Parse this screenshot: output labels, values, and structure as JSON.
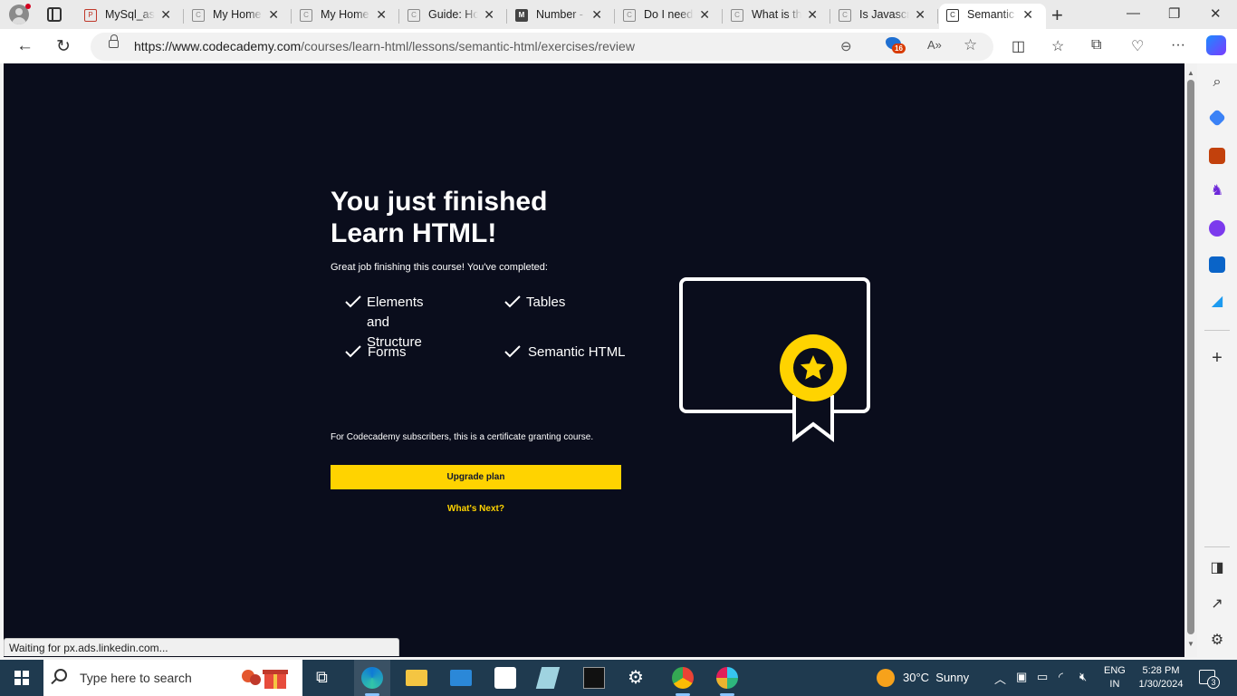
{
  "browser": {
    "tabs": [
      {
        "title": "MySql_assignment",
        "favicon": "pdf-icon"
      },
      {
        "title": "My Home | Codecademy",
        "favicon": "codecademy-icon"
      },
      {
        "title": "My Home | Codecademy",
        "favicon": "codecademy-icon"
      },
      {
        "title": "Guide: How to...",
        "favicon": "codecademy-icon"
      },
      {
        "title": "Number - JavaScript",
        "favicon": "medium-icon"
      },
      {
        "title": "Do I need...",
        "favicon": "codecademy-icon"
      },
      {
        "title": "What is the...",
        "favicon": "codecademy-icon"
      },
      {
        "title": "Is Javascript...",
        "favicon": "codecademy-icon"
      },
      {
        "title": "Semantic HTML",
        "favicon": "codecademy-icon",
        "active": true
      }
    ],
    "url_domain": "https://www.codecademy.com",
    "url_path": "/courses/learn-html/lessons/semantic-html/exercises/review",
    "extension_badge": "16",
    "status_text": "Waiting for px.ads.linkedin.com..."
  },
  "page": {
    "title_line1": "You just finished",
    "title_line2": "Learn HTML!",
    "subtitle": "Great job finishing this course! You've completed:",
    "completed": [
      {
        "line1": "Elements and",
        "line2": "Structure"
      },
      {
        "line1": "Tables",
        "line2": ""
      },
      {
        "line1": "Forms",
        "line2": ""
      },
      {
        "line1": "Semantic HTML",
        "line2": ""
      }
    ],
    "subscriber_note": "For Codecademy subscribers, this is a certificate granting course.",
    "upgrade_label": "Upgrade plan",
    "whats_next_label": "What's Next?",
    "accent_color": "#FFD300",
    "background_color": "#0A0D1C"
  },
  "taskbar": {
    "search_placeholder": "Type here to search",
    "weather_temp": "30°C",
    "weather_text": "Sunny",
    "lang_line1": "ENG",
    "lang_line2": "IN",
    "time": "5:28 PM",
    "date": "1/30/2024",
    "notification_count": "3"
  }
}
